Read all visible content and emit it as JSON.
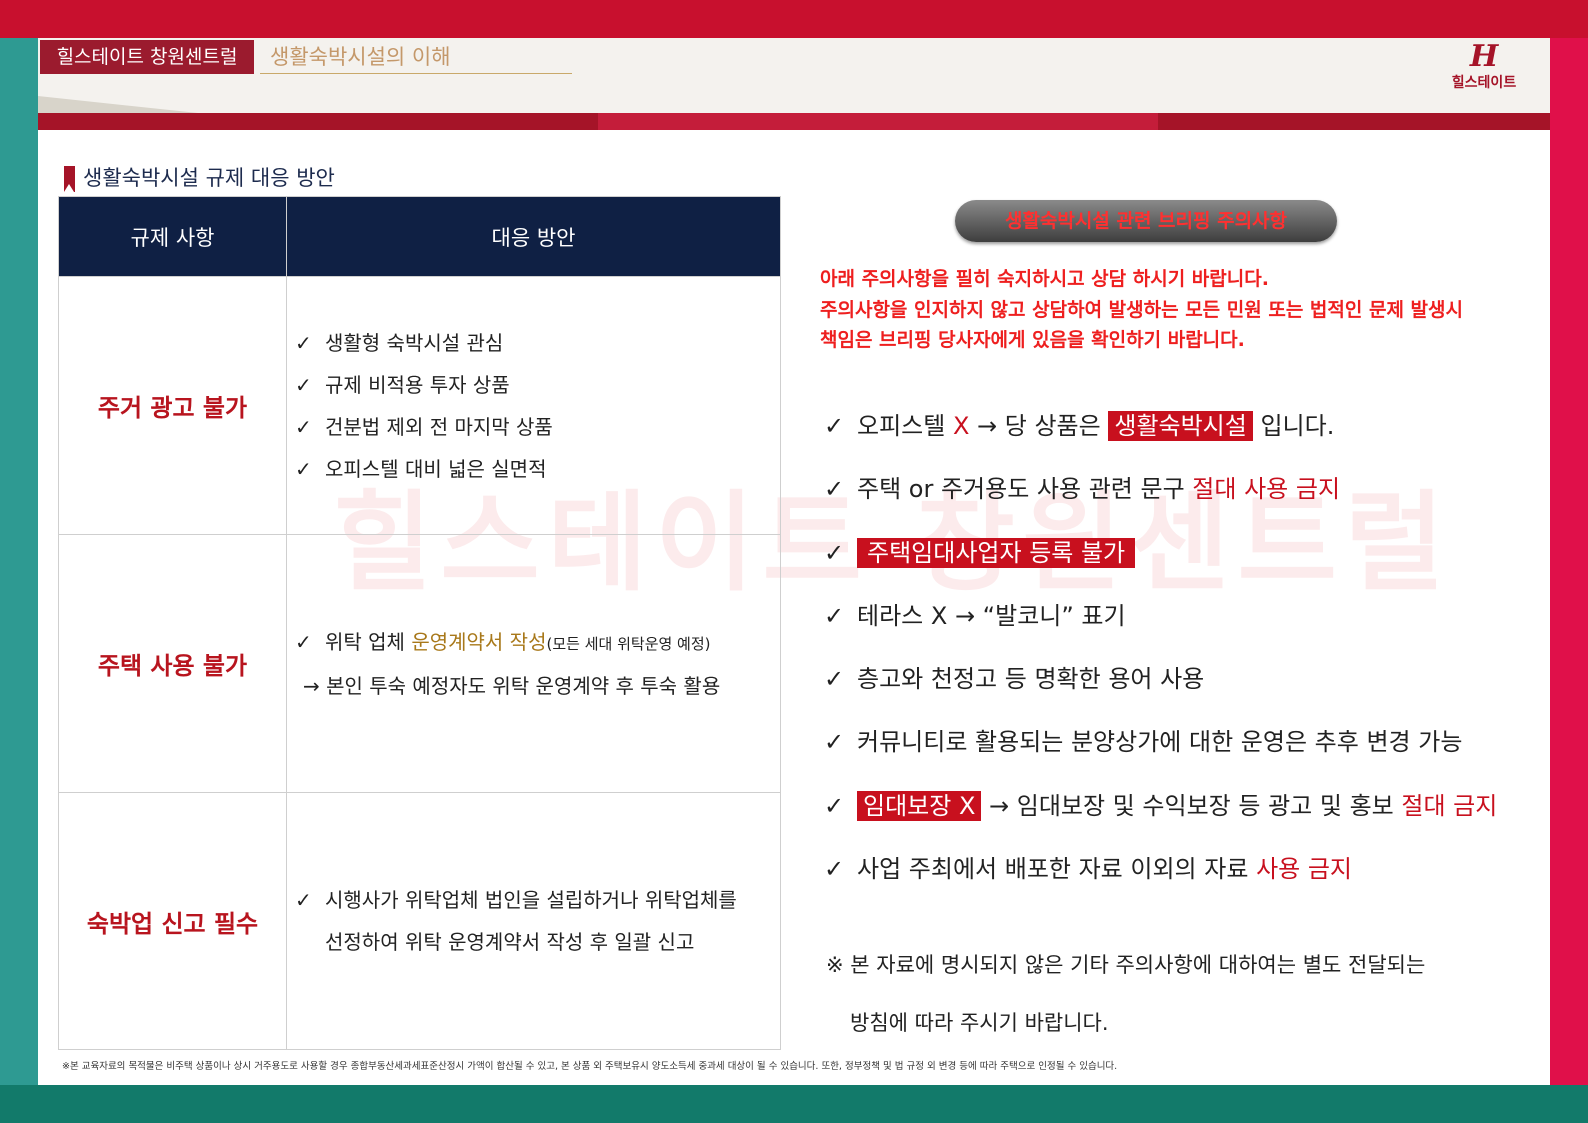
{
  "header": {
    "brand_title": "힐스테이트 창원센트럴",
    "page_subtitle": "생활숙박시설의 이해",
    "logo_text": "힐스테이트",
    "logo_mark": "H"
  },
  "section": {
    "title": "생활숙박시설 규제 대응 방안"
  },
  "table": {
    "headers": [
      "규제 사항",
      "대응 방안"
    ],
    "rows": [
      {
        "rule": "주거 광고 불가",
        "lines": [
          "생활형 숙박시설 관심",
          "규제 비적용 투자 상품",
          "건분법 제외 전 마지막 상품",
          "오피스텔 대비 넓은 실면적"
        ]
      },
      {
        "rule": "주택 사용 불가",
        "line1_prefix": "위탁 업체 ",
        "line1_highlight": "운영계약서 작성",
        "line1_small": "(모든 세대 위탁운영 예정)",
        "line2": "→ 본인 투숙 예정자도 위탁 운영계약 후 투숙 활용"
      },
      {
        "rule": "숙박업 신고 필수",
        "lines": [
          "시행사가 위탁업체 법인을 설립하거나 위탁업체를",
          "선정하여 위탁 운영계약서 작성 후 일괄 신고"
        ]
      }
    ],
    "check_symbol": "✓"
  },
  "right": {
    "pill_title": "생활숙박시설 관련 브리핑 주의사항",
    "notice_lines": [
      "아래 주의사항을 필히 숙지하시고 상담 하시기 바랍니다.",
      "주의사항을 인지하지 않고 상담하여 발생하는 모든 민원 또는 법적인 문제 발생시",
      "책임은 브리핑 당사자에게 있음을 확인하기 바랍니다."
    ],
    "points": {
      "p1": {
        "a": "오피스텔 ",
        "b": "X",
        "c": " → 당 상품은 ",
        "badge": "생활숙박시설",
        "d": " 입니다."
      },
      "p2": {
        "a": "주택 or 주거용도 사용 관련 문구 ",
        "red": "절대 사용 금지"
      },
      "p3": {
        "badge": "주택임대사업자 등록 불가"
      },
      "p4": {
        "a": "테라스 X → “발코니” 표기"
      },
      "p5": {
        "a": "층고와 천정고 등 명확한 용어 사용"
      },
      "p6": {
        "a": "커뮤니티로 활용되는 분양상가에 대한 운영은 추후 변경 가능"
      },
      "p7": {
        "badge": "임대보장 X",
        "a": " → 임대보장 및 수익보장 등 광고 및 홍보 ",
        "red": "절대 금지"
      },
      "p8": {
        "a": "사업 주최에서 배포한 자료 이외의 자료 ",
        "red": "사용 금지"
      }
    },
    "remark_lines": [
      "※ 본 자료에 명시되지 않은 기타 주의사항에 대하여는 별도 전달되는",
      "방침에 따라 주시기 바랍니다."
    ]
  },
  "footnote": "※본 교육자료의 목적물은 비주택 상품이나 상시 거주용도로 사용할 경우 종합부동산세과세표준산정시 가액이 합산될 수 있고, 본 상품 외 주택보유시 양도소득세 중과세 대상이 될 수 있습니다. 또한, 정부정책 및 법 규정 외 변경 등에 따라 주택으로 인정될 수 있습니다.",
  "watermark": "힐스테이트 창원센트럴",
  "colors": {
    "frame_top": "#c8102e",
    "frame_left": "#2e9a92",
    "frame_right": "#e0104a",
    "frame_bottom": "#127a6a",
    "table_header": "#0f2044",
    "accent_red": "#c8101e",
    "brand_maroon": "#9b1b2e"
  }
}
